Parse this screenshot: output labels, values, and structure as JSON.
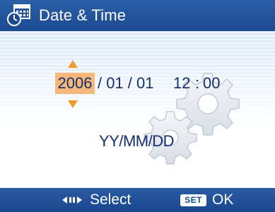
{
  "header": {
    "title": "Date & Time",
    "icon": "calendar-clock-icon"
  },
  "datetime": {
    "year": "2006",
    "month_day": "/ 01 / 01",
    "hour": "12",
    "separator": ":",
    "minute": "00",
    "format": "YY/MM/DD"
  },
  "footer": {
    "select_icon": "left-right-arrows-icon",
    "select_label": "Select",
    "set_key_label": "SET",
    "ok_label": "OK"
  },
  "colors": {
    "bar_blue": "#1b4a92",
    "highlight_orange": "#f6b77a",
    "arrow_orange": "#f39a2c",
    "text_navy": "#16306e"
  }
}
